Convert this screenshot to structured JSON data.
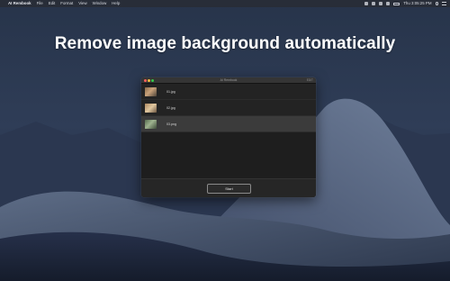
{
  "menubar": {
    "app_name": "AI Rembook",
    "menus": [
      "File",
      "Edit",
      "Format",
      "View",
      "Window",
      "Help"
    ],
    "clock": "Thu 3:05:25 PM"
  },
  "headline": "Remove image background automatically",
  "window": {
    "title": "AI Rembook",
    "top_right": "EDIT",
    "files": [
      {
        "name": "01.jpg",
        "selected": false
      },
      {
        "name": "02.jpg",
        "selected": false
      },
      {
        "name": "03.png",
        "selected": true
      }
    ],
    "start_label": "Start"
  },
  "colors": {
    "traffic_close": "#fc605c",
    "traffic_min": "#fdbc40",
    "traffic_max": "#34c84a"
  }
}
